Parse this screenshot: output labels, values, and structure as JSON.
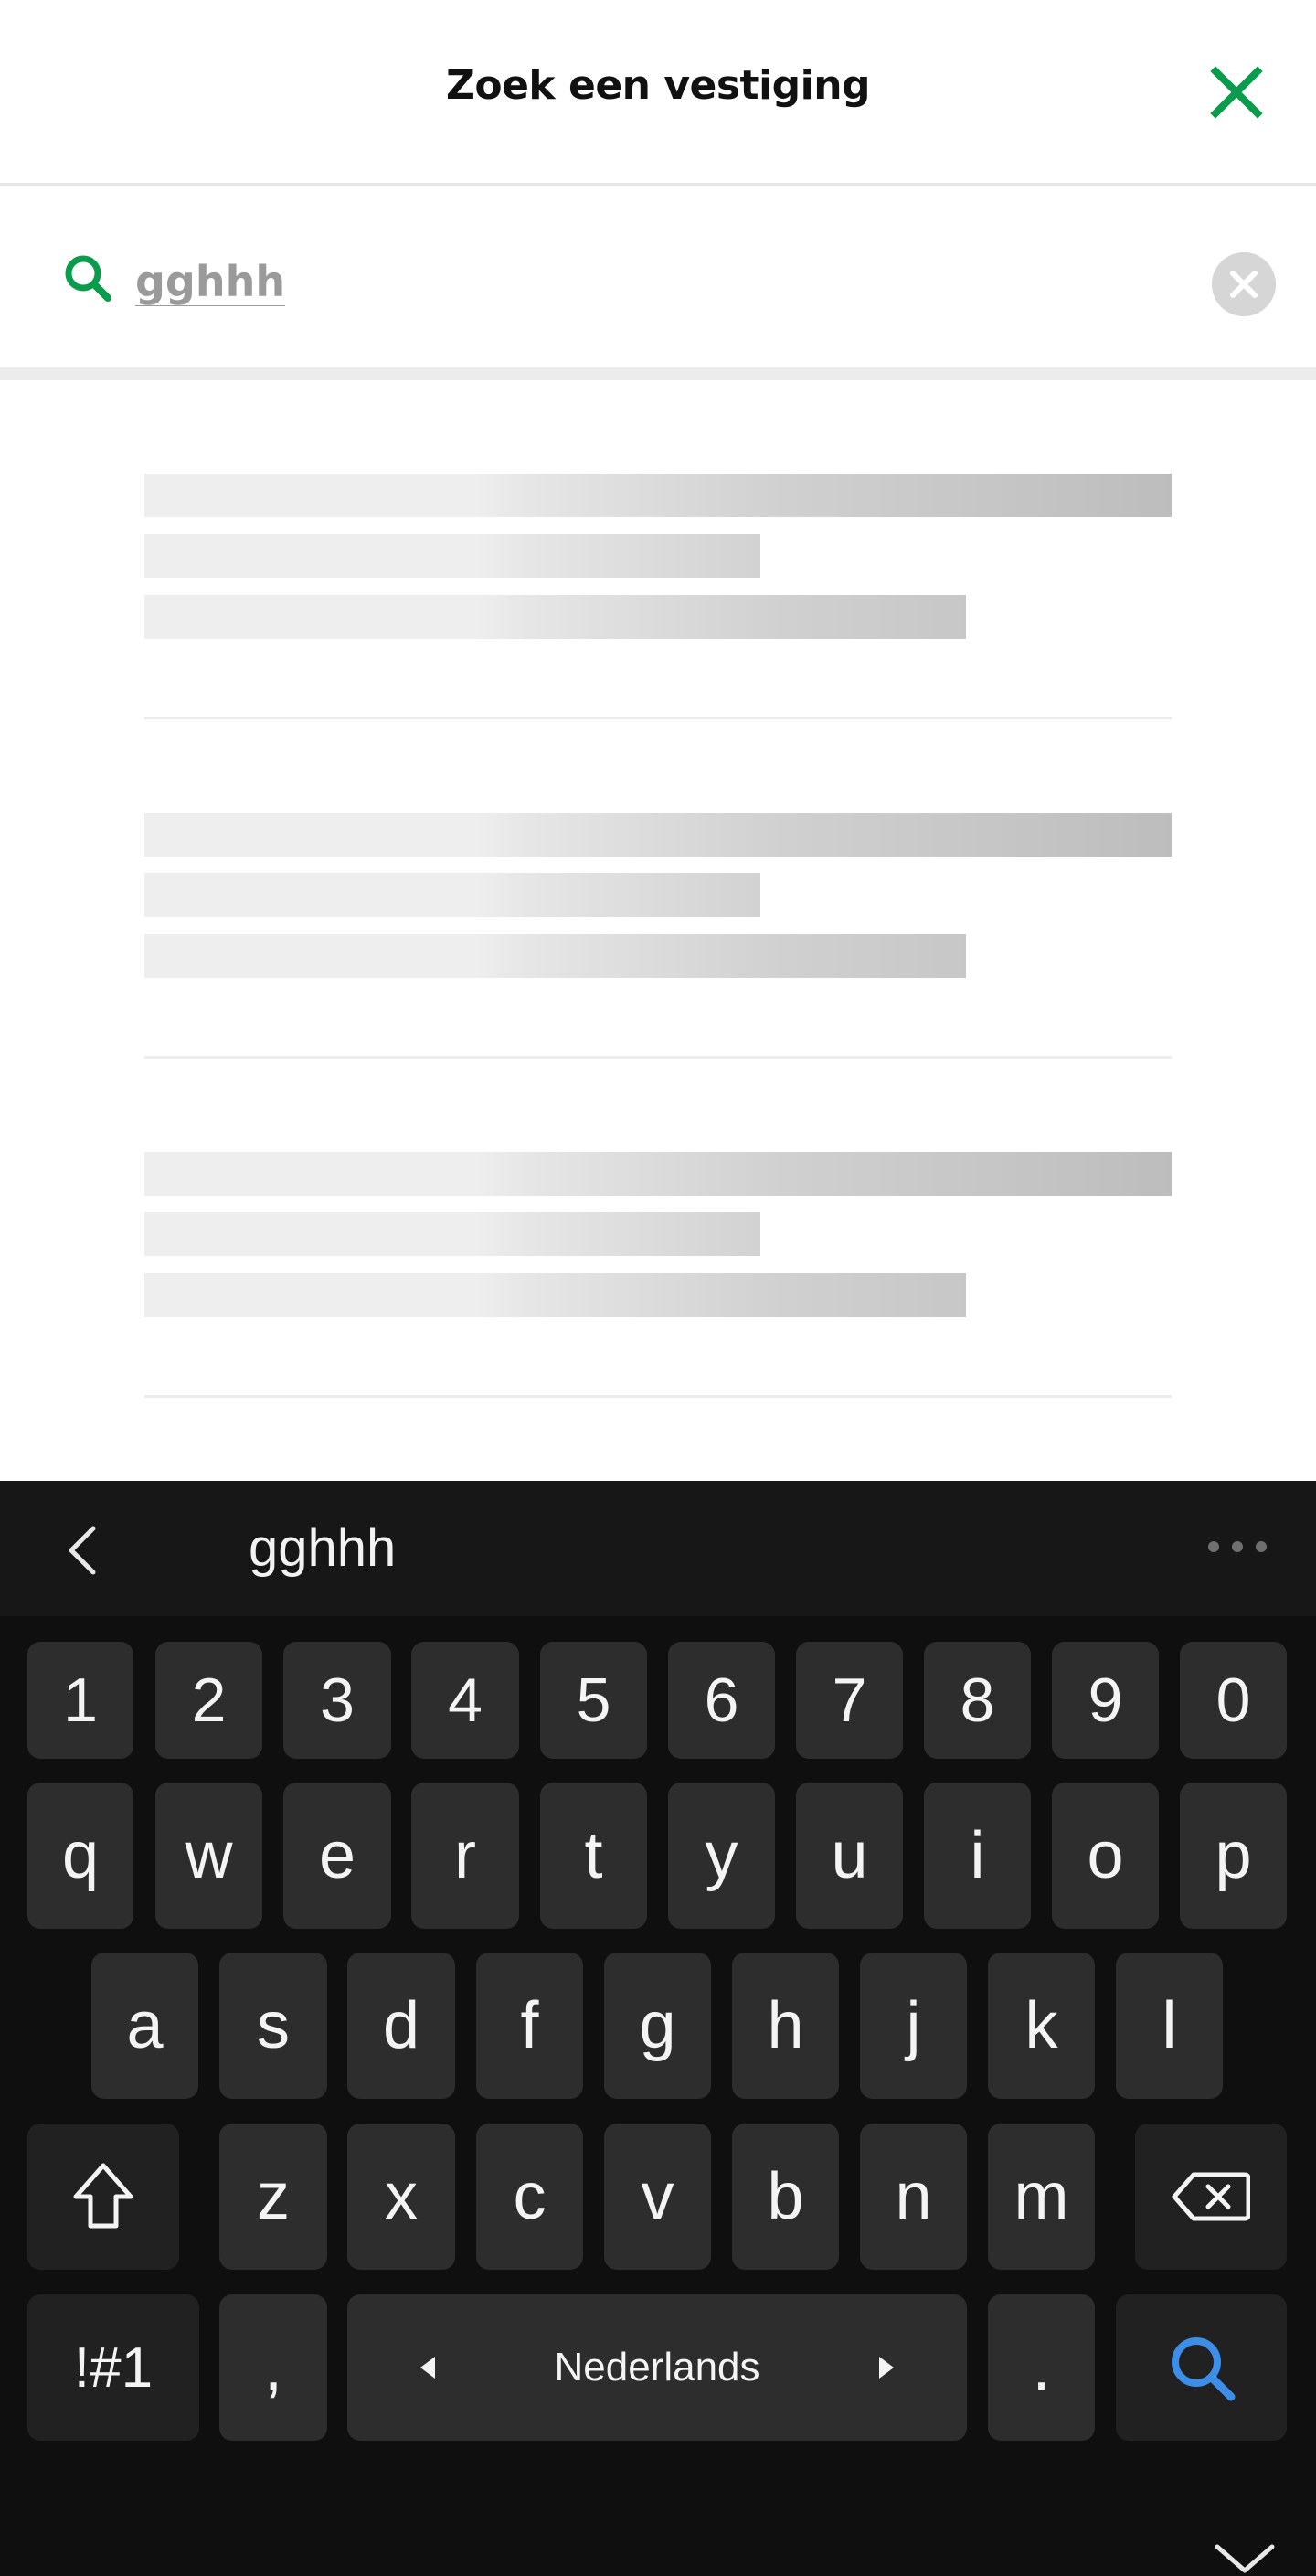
{
  "header": {
    "title": "Zoek een vestiging",
    "close_icon": "close-icon",
    "accent_color": "#0a9b4d"
  },
  "search": {
    "value": "gghhh",
    "icon": "search-icon",
    "clear_icon": "clear-circle-icon"
  },
  "results": {
    "state": "loading",
    "skeleton_count": 3
  },
  "keyboard": {
    "suggestion": "gghhh",
    "back_icon": "chevron-left-icon",
    "more_icon": "more-dots-icon",
    "numbers": [
      "1",
      "2",
      "3",
      "4",
      "5",
      "6",
      "7",
      "8",
      "9",
      "0"
    ],
    "row1": [
      "q",
      "w",
      "e",
      "r",
      "t",
      "y",
      "u",
      "i",
      "o",
      "p"
    ],
    "row2": [
      "a",
      "s",
      "d",
      "f",
      "g",
      "h",
      "j",
      "k",
      "l"
    ],
    "row3": [
      "z",
      "x",
      "c",
      "v",
      "b",
      "n",
      "m"
    ],
    "shift_icon": "shift-arrow-icon",
    "backspace_icon": "backspace-icon",
    "symbols_label": "!#1",
    "comma_label": ",",
    "space_label": "Nederlands",
    "period_label": ".",
    "search_key_icon": "search-icon",
    "search_key_color": "#3d8ee6",
    "hide_icon": "chevron-down-icon"
  }
}
